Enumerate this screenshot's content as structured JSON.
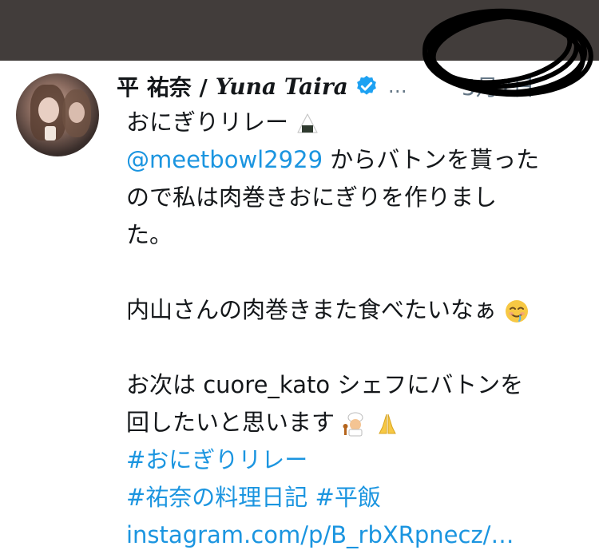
{
  "tweet": {
    "author_name": "平 祐奈 /",
    "author_name_en": "Yuna Taira",
    "more_menu": "…",
    "date": "5月2日",
    "lines": {
      "l1": "おにぎりリレー",
      "l2_mention": "@meetbowl2929",
      "l2_rest": " からバトンを貰った",
      "l3": "ので私は肉巻きおにぎりを作りまし",
      "l4": "た。",
      "l5": "内山さんの肉巻きまた食べたいなぁ",
      "l6": "お次は cuore_kato シェフにバトンを",
      "l7": "回したいと思います",
      "l8": "#おにぎりリレー",
      "l9a": "#祐奈の料理日記",
      "l9b": "#平飯",
      "l10": "instagram.com/p/B_rbXRpnecz/…"
    }
  },
  "icons": {
    "verified": "verified-badge-icon",
    "onigiri": "onigiri-emoji",
    "smile": "drooling-smile-emoji",
    "chef": "chef-emoji",
    "pray": "folded-hands-emoji"
  },
  "colors": {
    "link": "#1b95e0",
    "verified": "#1da1f2",
    "topbar": "#423d3b"
  }
}
